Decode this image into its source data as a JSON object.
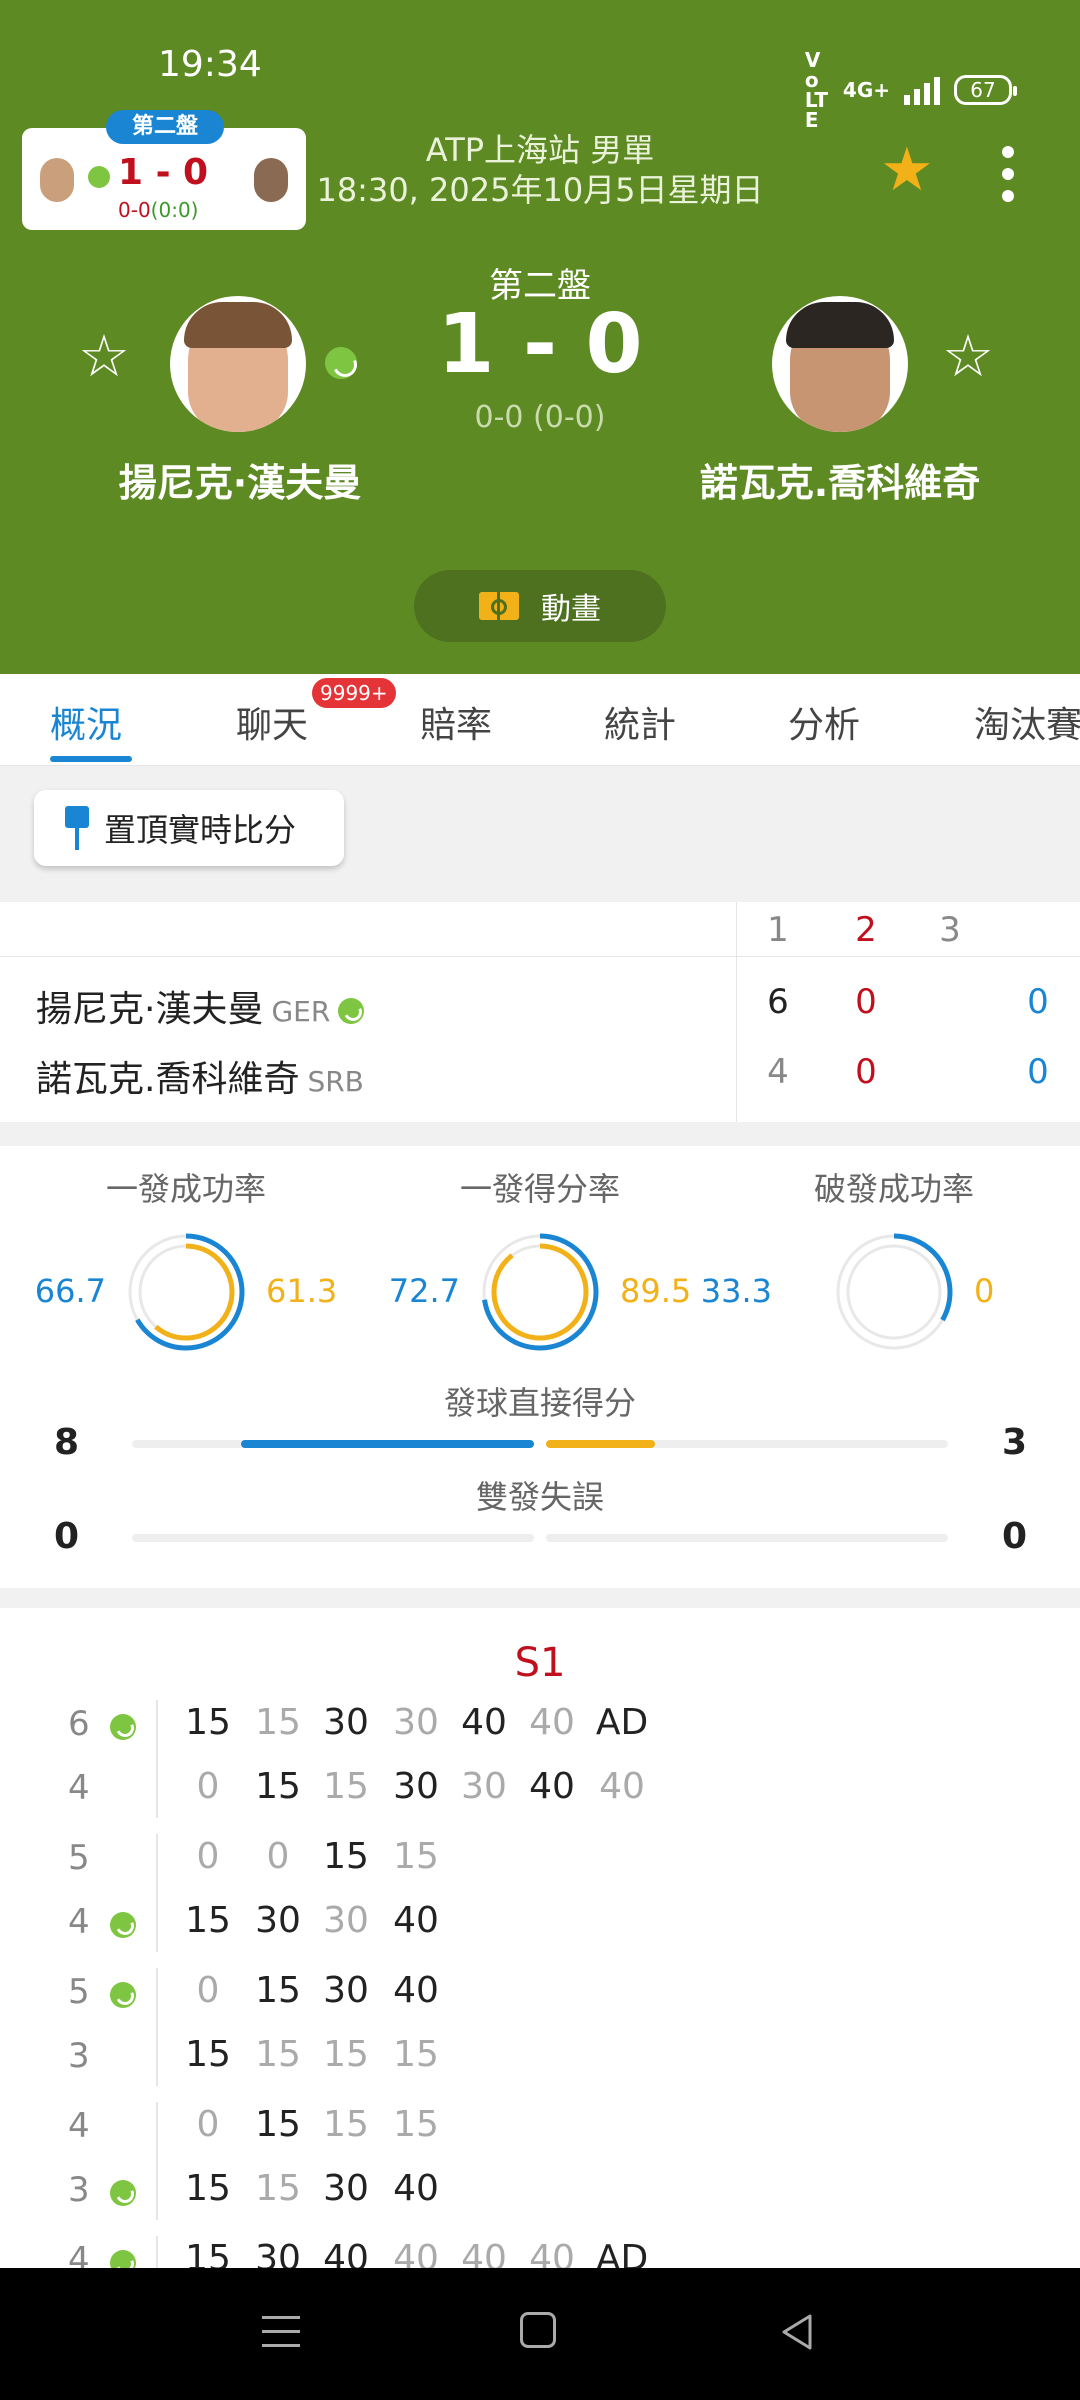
{
  "status_bar": {
    "time": "19:34",
    "network": "VoLTE",
    "signal": "4G+",
    "battery": "67"
  },
  "mini_card": {
    "set_label": "第二盤",
    "score": "1 - 0",
    "sub_game": "0-0",
    "sub_point": "(0:0)"
  },
  "header": {
    "tournament": "ATP上海站 男單",
    "datetime": "18:30, 2025年10月5日星期日",
    "set_label": "第二盤",
    "score": "1 - 0",
    "sub_score": "0-0 (0-0)",
    "player1": "揚尼克·漢夫曼",
    "player2": "諾瓦克.喬科維奇",
    "animation_label": "動畫"
  },
  "tabs": [
    {
      "label": "概況"
    },
    {
      "label": "聊天"
    },
    {
      "label": "賠率"
    },
    {
      "label": "統計"
    },
    {
      "label": "分析"
    },
    {
      "label": "淘汰賽"
    }
  ],
  "chat_badge": "9999+",
  "pin_button": "置頂實時比分",
  "scoreboard": {
    "set_headers": [
      "1",
      "2",
      "3"
    ],
    "rows": [
      {
        "name": "揚尼克·漢夫曼",
        "country": "GER",
        "sets": [
          "6",
          "0"
        ],
        "points": "0"
      },
      {
        "name": "諾瓦克.喬科維奇",
        "country": "SRB",
        "sets": [
          "4",
          "0"
        ],
        "points": "0"
      }
    ]
  },
  "stats": [
    {
      "title": "一發成功率",
      "left": "66.7",
      "right": "61.3",
      "left_frac": 0.667,
      "right_frac": 0.613
    },
    {
      "title": "一發得分率",
      "left": "72.7",
      "right": "89.5",
      "left_frac": 0.727,
      "right_frac": 0.895
    },
    {
      "title": "破發成功率",
      "left": "33.3",
      "right": "0",
      "left_frac": 0.333,
      "right_frac": 0
    }
  ],
  "bars": [
    {
      "title": "發球直接得分",
      "left": "8",
      "right": "3",
      "left_share": 0.73,
      "right_share": 0.27
    },
    {
      "title": "雙發失誤",
      "left": "0",
      "right": "0",
      "left_share": 0,
      "right_share": 0
    }
  ],
  "pbp": {
    "set_label": "S1",
    "games": [
      {
        "top_score": "6",
        "bottom_score": "4",
        "server": "top",
        "top_points": [
          "15",
          "15",
          "30",
          "30",
          "40",
          "40",
          "AD"
        ],
        "bottom_points": [
          "0",
          "15",
          "15",
          "30",
          "30",
          "40",
          "40"
        ],
        "top_wins": [
          true,
          false,
          true,
          false,
          true,
          false,
          true
        ]
      },
      {
        "top_score": "5",
        "bottom_score": "4",
        "server": "bottom",
        "top_points": [
          "0",
          "0",
          "15",
          "15"
        ],
        "bottom_points": [
          "15",
          "30",
          "30",
          "40"
        ],
        "top_wins": [
          false,
          false,
          true,
          false
        ]
      },
      {
        "top_score": "5",
        "bottom_score": "3",
        "server": "top",
        "top_points": [
          "0",
          "15",
          "30",
          "40"
        ],
        "bottom_points": [
          "15",
          "15",
          "15",
          "15"
        ],
        "top_wins": [
          false,
          true,
          true,
          true
        ]
      },
      {
        "top_score": "4",
        "bottom_score": "3",
        "server": "bottom",
        "top_points": [
          "0",
          "15",
          "15",
          "15"
        ],
        "bottom_points": [
          "15",
          "15",
          "30",
          "40"
        ],
        "top_wins": [
          false,
          true,
          false,
          false
        ]
      },
      {
        "top_score": "4",
        "bottom_score": "",
        "server": "top",
        "top_points": [
          "15",
          "30",
          "40",
          "40",
          "40",
          "40",
          "AD"
        ],
        "bottom_points": [],
        "top_wins": [
          true,
          true,
          true,
          false,
          false,
          false,
          true
        ]
      }
    ]
  },
  "colors": {
    "header_green": "#5d8a23",
    "accent_blue": "#1a86d3",
    "accent_orange": "#f2b118",
    "score_red": "#c0101e",
    "ball_green": "#7ec642"
  }
}
